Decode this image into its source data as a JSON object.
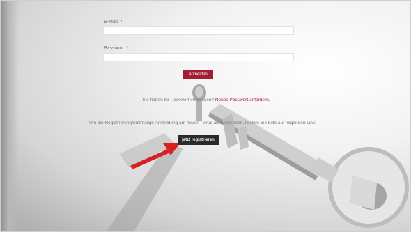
{
  "form": {
    "email_label": "E-Mail: *",
    "email_value": "",
    "password_label": "Passwort: *",
    "password_value": "",
    "login_button": "anmelden"
  },
  "forgot": {
    "text": "Sie haben Ihr Passwort vergessen? ",
    "link": "Neues Passwort anfordern."
  },
  "registration": {
    "text": "Um die Registrierung/erstmalige Anmeldung am neuen Portal abzuschließen, klicken Sie bitte auf folgenden Link:",
    "button": "jetzt registrieren"
  },
  "colors": {
    "accent": "#a31e35",
    "register_button": "#2a2a2a",
    "arrow": "#d92020"
  },
  "icons": {
    "arrow": "red-arrow-pointer",
    "background": "key-illustration"
  }
}
